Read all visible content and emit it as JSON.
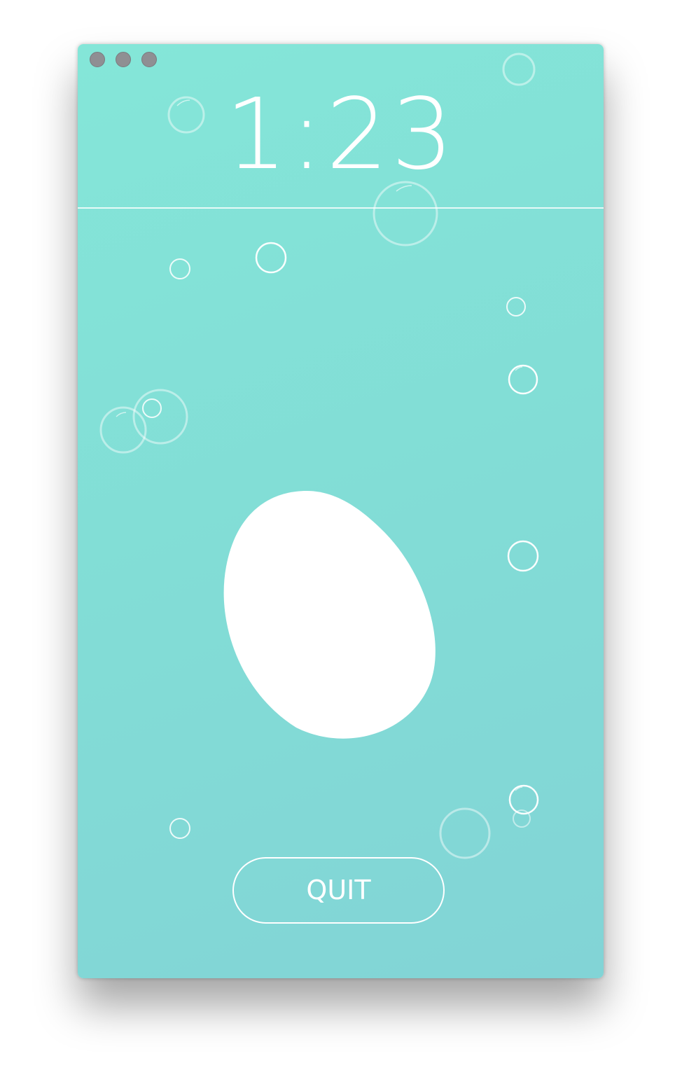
{
  "timer": {
    "display": "1:23"
  },
  "quit_button": {
    "label": "QUIT"
  },
  "colors": {
    "background_top": "#84e6d8",
    "background_bottom": "#82d4d6",
    "foreground": "#ffffff",
    "traffic_light": "#8f8f93"
  },
  "icons": {
    "window_controls": [
      "close-dot",
      "minimize-dot",
      "zoom-dot"
    ],
    "egg": "egg-icon",
    "bubbles": "bubble-icon"
  }
}
